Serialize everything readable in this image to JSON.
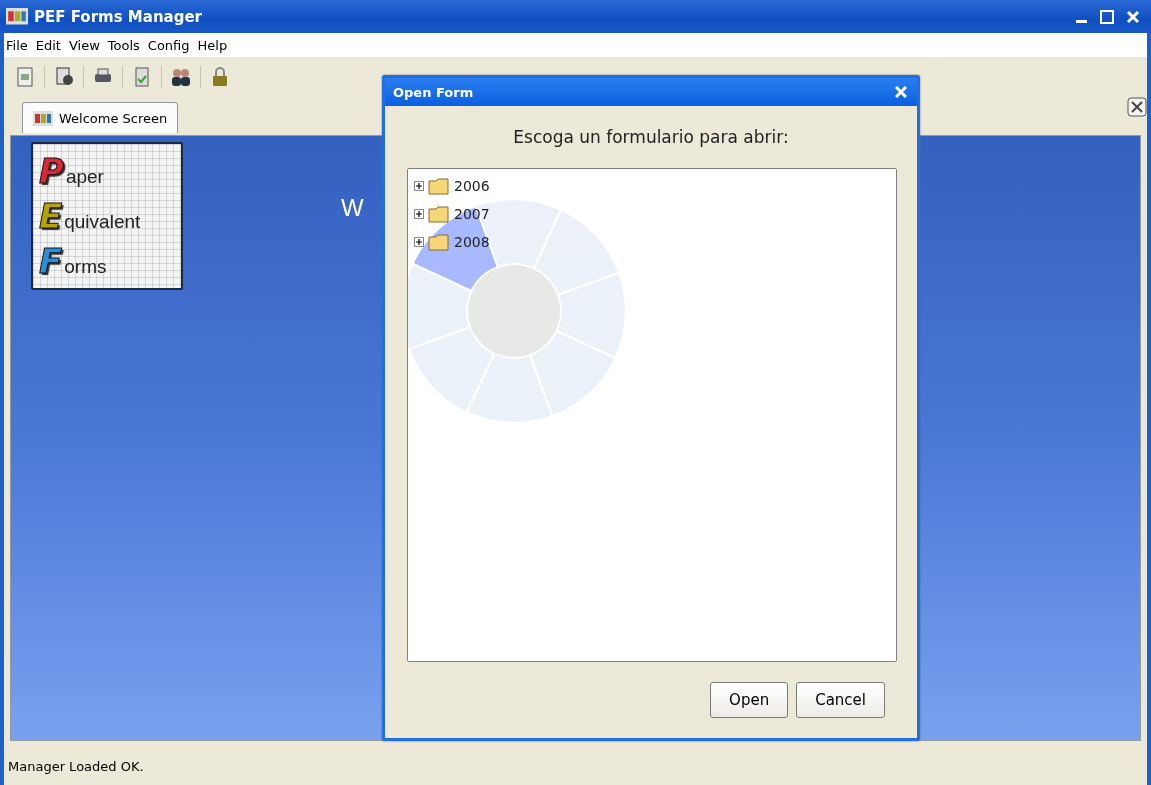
{
  "window": {
    "title": "PEF Forms Manager"
  },
  "menu": [
    "File",
    "Edit",
    "View",
    "Tools",
    "Config",
    "Help"
  ],
  "toolbar": [
    {
      "kind": "page"
    },
    {
      "kind": "preview"
    },
    {
      "kind": "print"
    },
    {
      "kind": "check"
    },
    {
      "kind": "users"
    },
    {
      "kind": "lock"
    }
  ],
  "tabs": [
    {
      "label": "Welcome Screen",
      "selected": true
    }
  ],
  "logo": [
    {
      "initial": "P",
      "rest": "aper",
      "color": "#d8283a"
    },
    {
      "initial": "E",
      "rest": "quivalent",
      "color": "#b8a400"
    },
    {
      "initial": "F",
      "rest": "orms",
      "color": "#2a8fd8"
    }
  ],
  "welcome_heading": "W",
  "dialog": {
    "title": "Open Form",
    "prompt": "Escoga un formulario para abrir:",
    "tree": [
      {
        "label": "2006",
        "expanded": false
      },
      {
        "label": "2007",
        "expanded": false
      },
      {
        "label": "2008",
        "expanded": false
      }
    ],
    "buttons": [
      "Open",
      "Cancel"
    ]
  },
  "status_bar": "Manager Loaded OK."
}
